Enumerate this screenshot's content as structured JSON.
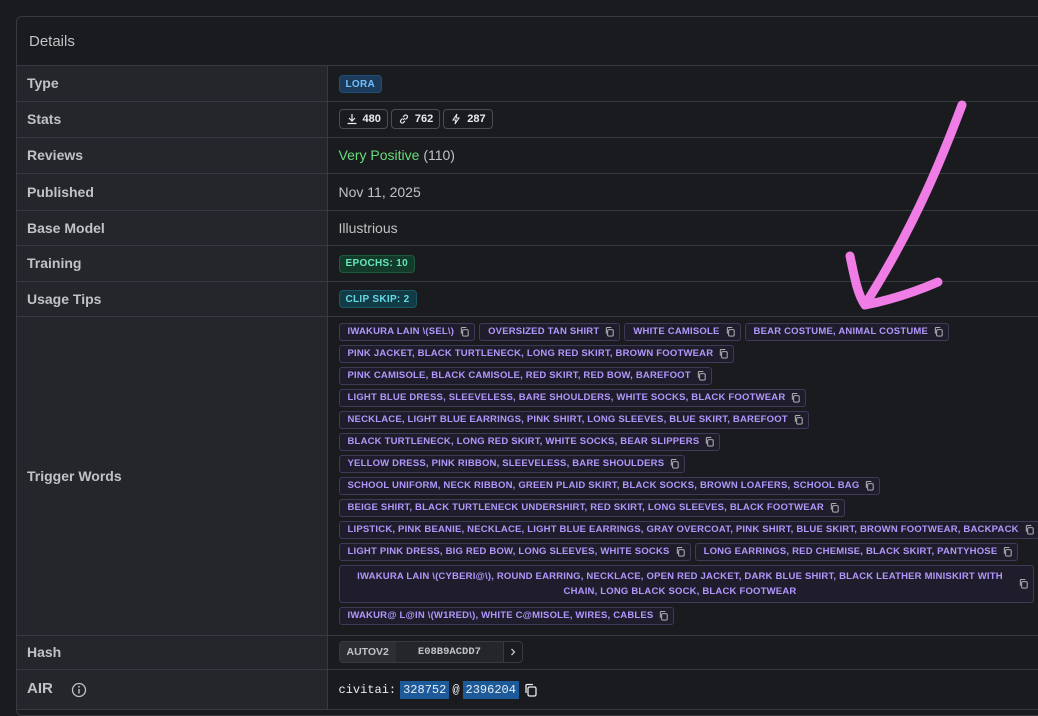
{
  "header": {
    "title": "Details"
  },
  "rows": {
    "type": {
      "label": "Type",
      "badge": "LORA"
    },
    "stats": {
      "label": "Stats",
      "downloads": "480",
      "links": "762",
      "generations": "287"
    },
    "reviews": {
      "label": "Reviews",
      "sentiment": "Very Positive",
      "count": "(110)"
    },
    "published": {
      "label": "Published",
      "value": "Nov 11, 2025"
    },
    "base_model": {
      "label": "Base Model",
      "value": "Illustrious"
    },
    "training": {
      "label": "Training",
      "badge": "EPOCHS: 10"
    },
    "usage_tips": {
      "label": "Usage Tips",
      "badge": "CLIP SKIP: 2"
    },
    "trigger_words": {
      "label": "Trigger Words",
      "rows": [
        [
          "IWAKURA LAIN \\(SEL\\)",
          "OVERSIZED TAN SHIRT",
          "WHITE CAMISOLE",
          "BEAR COSTUME, ANIMAL COSTUME"
        ],
        [
          "PINK JACKET, BLACK TURTLENECK, LONG RED SKIRT, BROWN FOOTWEAR"
        ],
        [
          "PINK CAMISOLE, BLACK CAMISOLE, RED SKIRT, RED BOW, BAREFOOT"
        ],
        [
          "LIGHT BLUE DRESS, SLEEVELESS, BARE SHOULDERS, WHITE SOCKS, BLACK FOOTWEAR"
        ],
        [
          "NECKLACE, LIGHT BLUE EARRINGS, PINK SHIRT, LONG SLEEVES, BLUE SKIRT, BAREFOOT"
        ],
        [
          "BLACK TURTLENECK, LONG RED SKIRT, WHITE SOCKS, BEAR SLIPPERS"
        ],
        [
          "YELLOW DRESS, PINK RIBBON, SLEEVELESS, BARE SHOULDERS"
        ],
        [
          "SCHOOL UNIFORM, NECK RIBBON, GREEN PLAID SKIRT, BLACK SOCKS, BROWN LOAFERS, SCHOOL BAG"
        ],
        [
          "BEIGE SHIRT, BLACK TURTLENECK UNDERSHIRT, RED SKIRT, LONG SLEEVES, BLACK FOOTWEAR"
        ],
        [
          "LIPSTICK, PINK BEANIE, NECKLACE, LIGHT BLUE EARRINGS, GRAY OVERCOAT, PINK SHIRT, BLUE SKIRT, BROWN FOOTWEAR, BACKPACK"
        ],
        [
          "LIGHT PINK DRESS, BIG RED BOW, LONG SLEEVES, WHITE SOCKS",
          "LONG EARRINGS, RED CHEMISE, BLACK SKIRT, PANTYHOSE"
        ],
        [
          "IWAKURA LAIN \\(CYBERI@\\), ROUND EARRING, NECKLACE, OPEN RED JACKET, DARK BLUE SHIRT, BLACK LEATHER MINISKIRT WITH CHAIN, LONG BLACK SOCK, BLACK FOOTWEAR"
        ],
        [
          "IWAKUR@ L@IN \\(W1RED\\), WHITE C@MISOLE, WIRES, CABLES"
        ]
      ]
    },
    "hash": {
      "label": "Hash",
      "type": "AUTOV2",
      "value": "E08B9ACDD7"
    },
    "air": {
      "label": "AIR",
      "prefix": "civitai:",
      "model_id": "328752",
      "sep": "@",
      "version_id": "2396204"
    }
  },
  "annotation": {
    "arrow_color": "#f07ce6"
  },
  "icons": [
    "chevron-up-icon",
    "info-icon",
    "download-icon",
    "link-icon",
    "bolt-icon",
    "copy-icon",
    "chevron-right-icon"
  ]
}
